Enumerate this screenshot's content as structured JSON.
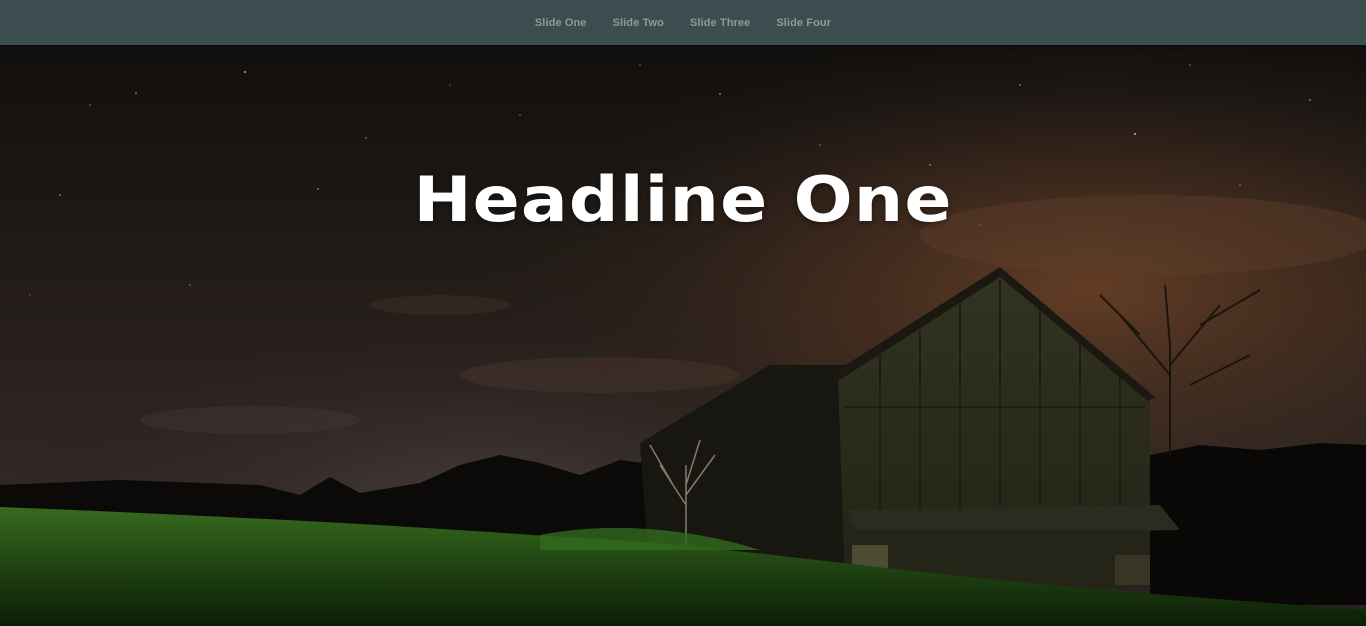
{
  "nav": {
    "items": [
      {
        "label": "Slide One"
      },
      {
        "label": "Slide Two"
      },
      {
        "label": "Slide Three"
      },
      {
        "label": "Slide Four"
      }
    ]
  },
  "slide": {
    "headline": "Headline One"
  },
  "colors": {
    "navbar": "#3b4d4f",
    "nav_text": "#8e9a9b",
    "headline": "#ffffff"
  }
}
